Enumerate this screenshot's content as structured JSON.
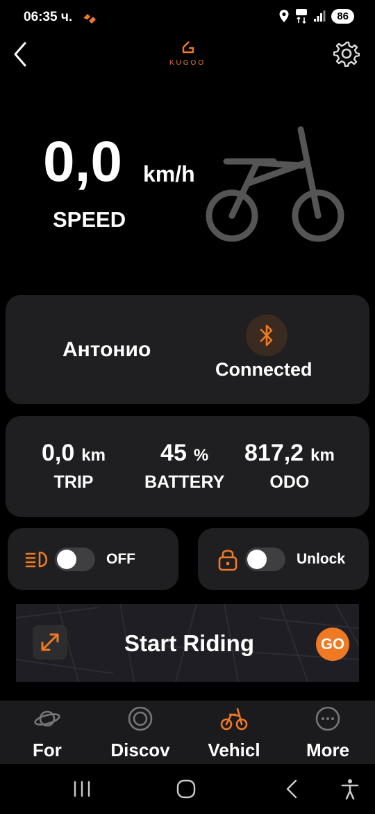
{
  "status_bar": {
    "time": "06:35 ч.",
    "battery": "86"
  },
  "speed": {
    "value": "0,0",
    "unit": "km/h",
    "label": "SPEED"
  },
  "device": {
    "name": "Антонио",
    "connection_status": "Connected"
  },
  "stats": [
    {
      "value": "0,0",
      "unit": "km",
      "label": "TRIP"
    },
    {
      "value": "45",
      "unit": "%",
      "label": "BATTERY"
    },
    {
      "value": "817,2",
      "unit": "km",
      "label": "ODO"
    }
  ],
  "controls": {
    "light_state": "OFF",
    "lock_state": "Unlock"
  },
  "start": {
    "label": "Start Riding",
    "go": "GO"
  },
  "nav": [
    {
      "label": "For",
      "icon": "planet-icon"
    },
    {
      "label": "Discov",
      "icon": "target-icon"
    },
    {
      "label": "Vehicl",
      "icon": "bike-icon"
    },
    {
      "label": "More",
      "icon": "more-dots-icon"
    }
  ],
  "colors": {
    "accent": "#f07a23",
    "background": "#000000",
    "card": "#1f1f21"
  }
}
